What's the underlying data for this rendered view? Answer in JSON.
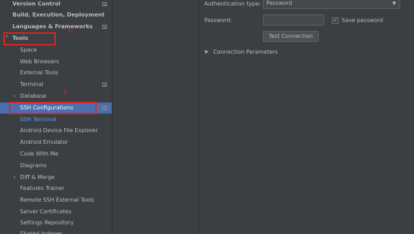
{
  "sidebar": {
    "items": [
      {
        "label": "Version Control",
        "bold": true,
        "chevron": "",
        "icon": true
      },
      {
        "label": "Build, Execution, Deployment",
        "bold": true,
        "chevron": "",
        "icon": false
      },
      {
        "label": "Languages & Frameworks",
        "bold": true,
        "chevron": "",
        "icon": true
      },
      {
        "label": "Tools",
        "bold": true,
        "chevron": "˅",
        "icon": false
      },
      {
        "label": "Space"
      },
      {
        "label": "Web Browsers"
      },
      {
        "label": "External Tools"
      },
      {
        "label": "Terminal",
        "icon": true
      },
      {
        "label": "Database",
        "chevron": "›"
      },
      {
        "label": "SSH Configurations",
        "selected": true,
        "icon": true
      },
      {
        "label": "SSH Terminal",
        "link": true
      },
      {
        "label": "Android Device File Explorer"
      },
      {
        "label": "Android Emulator"
      },
      {
        "label": "Code With Me"
      },
      {
        "label": "Diagrams"
      },
      {
        "label": "Diff & Merge",
        "chevron": "›"
      },
      {
        "label": "Features Trainer"
      },
      {
        "label": "Remote SSH External Tools"
      },
      {
        "label": "Server Certificates"
      },
      {
        "label": "Settings Repository"
      },
      {
        "label": "Shared Indexes"
      }
    ]
  },
  "form": {
    "auth_label": "Authentication type:",
    "auth_value": "Password",
    "password_label": "Password:",
    "password_value": "",
    "save_password_label": "Save password",
    "save_password_checked": "✓",
    "test_button": "Test Connection",
    "section_title": "Connection Parameters"
  },
  "annotations": {
    "one": "1.",
    "two": "2."
  },
  "colors": {
    "background": "#3c3f41",
    "selection": "#4b6eaf",
    "link": "#589df6",
    "annotation": "#e02424"
  }
}
